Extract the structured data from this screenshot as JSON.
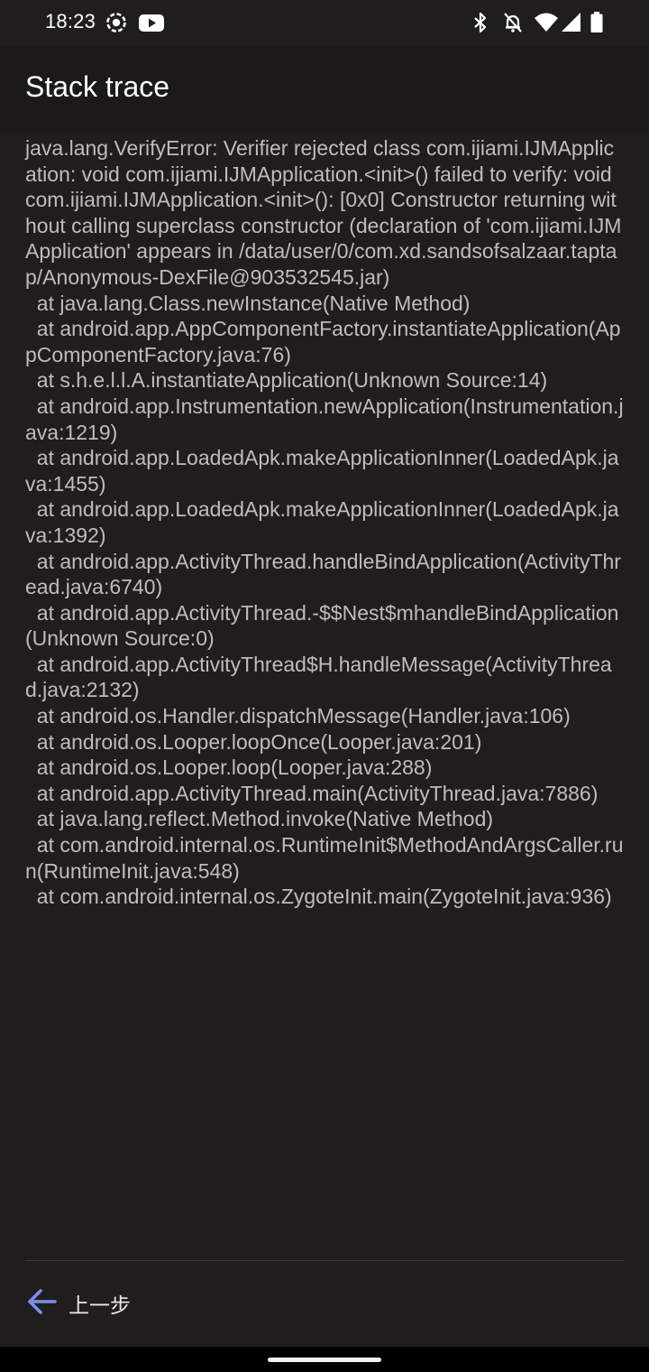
{
  "status_bar": {
    "time": "18:23",
    "left_icons": [
      "screen-record-icon",
      "youtube-icon"
    ],
    "right_icons": [
      "bluetooth-icon",
      "notifications-off-icon",
      "wifi-icon",
      "signal-icon",
      "battery-icon"
    ]
  },
  "header": {
    "title": "Stack trace"
  },
  "trace": {
    "text": "java.lang.VerifyError: Verifier rejected class com.ijiami.IJMApplication: void com.ijiami.IJMApplication.<init>() failed to verify: void com.ijiami.IJMApplication.<init>(): [0x0] Constructor returning without calling superclass constructor (declaration of 'com.ijiami.IJMApplication' appears in /data/user/0/com.xd.sandsofsalzaar.taptap/Anonymous-DexFile@903532545.jar)\n  at java.lang.Class.newInstance(Native Method)\n  at android.app.AppComponentFactory.instantiateApplication(AppComponentFactory.java:76)\n  at s.h.e.l.l.A.instantiateApplication(Unknown Source:14)\n  at android.app.Instrumentation.newApplication(Instrumentation.java:1219)\n  at android.app.LoadedApk.makeApplicationInner(LoadedApk.java:1455)\n  at android.app.LoadedApk.makeApplicationInner(LoadedApk.java:1392)\n  at android.app.ActivityThread.handleBindApplication(ActivityThread.java:6740)\n  at android.app.ActivityThread.-$$Nest$mhandleBindApplication(Unknown Source:0)\n  at android.app.ActivityThread$H.handleMessage(ActivityThread.java:2132)\n  at android.os.Handler.dispatchMessage(Handler.java:106)\n  at android.os.Looper.loopOnce(Looper.java:201)\n  at android.os.Looper.loop(Looper.java:288)\n  at android.app.ActivityThread.main(ActivityThread.java:7886)\n  at java.lang.reflect.Method.invoke(Native Method)\n  at com.android.internal.os.RuntimeInit$MethodAndArgsCaller.run(RuntimeInit.java:548)\n  at com.android.internal.os.ZygoteInit.main(ZygoteInit.java:936)"
  },
  "footer": {
    "back_label": "上一步",
    "back_icon": "arrow-left-icon"
  },
  "colors": {
    "background": "#201d1e",
    "trace_text": "#bfbcbc",
    "accent": "#7b8ff0"
  }
}
